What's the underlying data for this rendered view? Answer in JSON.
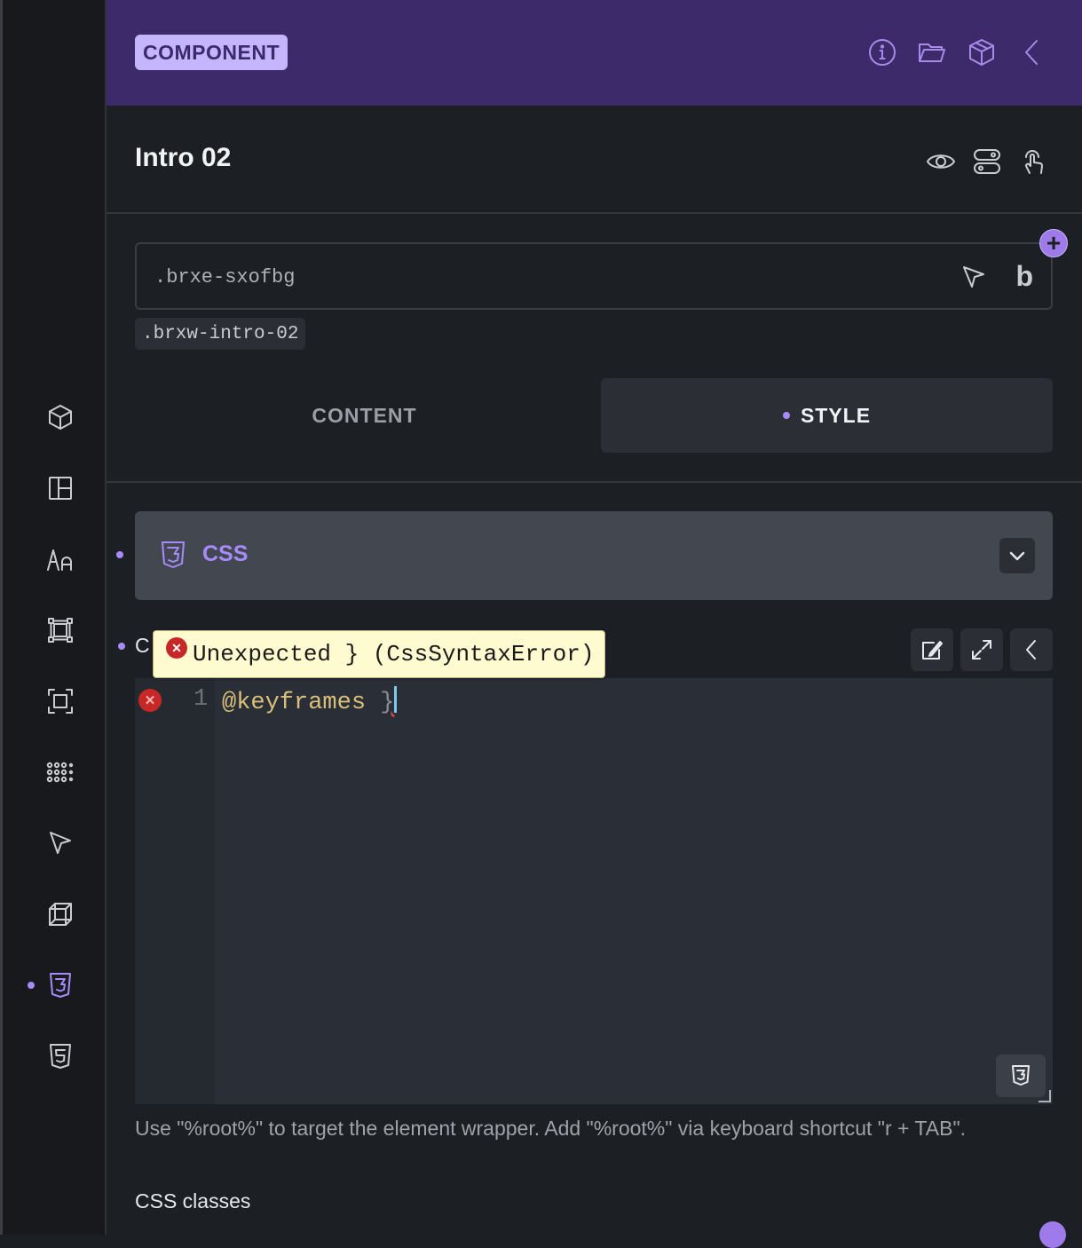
{
  "header": {
    "badge": "COMPONENT",
    "icons": [
      "info-icon",
      "folder-icon",
      "box-icon",
      "chevron-left-icon"
    ]
  },
  "element": {
    "title": "Intro 02",
    "icons": [
      "eye-icon",
      "toggle-icon",
      "pointer-touch-icon"
    ]
  },
  "class_selector": {
    "value": ".brxe-sxofbg",
    "b_label": "b",
    "add_label": "+",
    "chip": ".brxw-intro-02"
  },
  "tabs": [
    {
      "label": "CONTENT",
      "active": false
    },
    {
      "label": "STYLE",
      "active": true
    }
  ],
  "group": {
    "label": "CSS"
  },
  "control": {
    "label": "C",
    "tooltip": "Unexpected } (CssSyntaxError)",
    "line_number": "1",
    "code_keyword": "@keyframes",
    "code_brace": "}",
    "error_icon": "error-icon"
  },
  "help_text": "Use \"%root%\" to target the element wrapper. Add \"%root%\" via keyboard shortcut \"r + TAB\".",
  "next_label": "CSS classes",
  "sidebar": {
    "items": [
      "box-icon",
      "layout-icon",
      "typography-icon",
      "spacing-icon",
      "sizing-icon",
      "grid-dots-icon",
      "pointer-icon",
      "transform-icon",
      "css3-icon",
      "html5-icon"
    ],
    "active": "css3-icon"
  },
  "colors": {
    "accent": "#a78bfa",
    "header_bg": "#3d2a6b",
    "panel_bg": "#1c1f24",
    "error": "#c62828",
    "tooltip_bg": "#fffbd0"
  }
}
